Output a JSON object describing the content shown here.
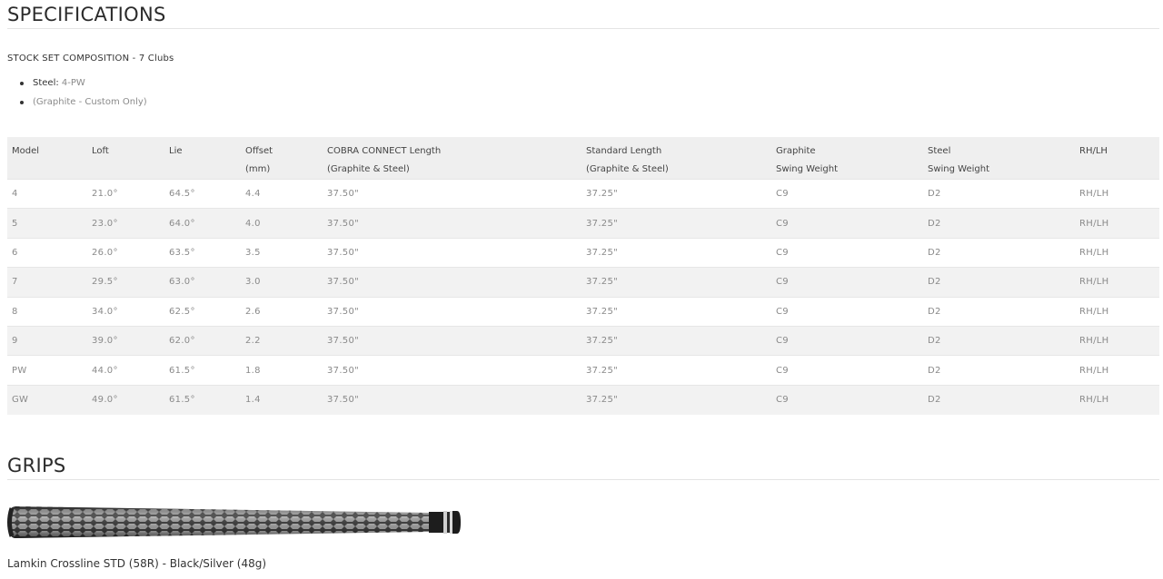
{
  "specs": {
    "title": "SPECIFICATIONS",
    "composition": "STOCK SET COMPOSITION - 7 Clubs",
    "bullets": {
      "steel_label": "Steel:",
      "steel_value": "4-PW",
      "graphite": "(Graphite - Custom Only)"
    },
    "headers": [
      {
        "l1": "Model",
        "l2": ""
      },
      {
        "l1": "Loft",
        "l2": ""
      },
      {
        "l1": "Lie",
        "l2": ""
      },
      {
        "l1": "Offset",
        "l2": "(mm)"
      },
      {
        "l1": "COBRA CONNECT Length",
        "l2": "(Graphite & Steel)"
      },
      {
        "l1": "Standard Length",
        "l2": "(Graphite & Steel)"
      },
      {
        "l1": "Graphite",
        "l2": "Swing Weight"
      },
      {
        "l1": "Steel",
        "l2": "Swing Weight"
      },
      {
        "l1": "RH/LH",
        "l2": ""
      }
    ],
    "rows": [
      [
        "4",
        "21.0°",
        "64.5°",
        "4.4",
        "37.50\"",
        "37.25\"",
        "C9",
        "D2",
        "RH/LH"
      ],
      [
        "5",
        "23.0°",
        "64.0°",
        "4.0",
        "37.50\"",
        "37.25\"",
        "C9",
        "D2",
        "RH/LH"
      ],
      [
        "6",
        "26.0°",
        "63.5°",
        "3.5",
        "37.50\"",
        "37.25\"",
        "C9",
        "D2",
        "RH/LH"
      ],
      [
        "7",
        "29.5°",
        "63.0°",
        "3.0",
        "37.50\"",
        "37.25\"",
        "C9",
        "D2",
        "RH/LH"
      ],
      [
        "8",
        "34.0°",
        "62.5°",
        "2.6",
        "37.50\"",
        "37.25\"",
        "C9",
        "D2",
        "RH/LH"
      ],
      [
        "9",
        "39.0°",
        "62.0°",
        "2.2",
        "37.50\"",
        "37.25\"",
        "C9",
        "D2",
        "RH/LH"
      ],
      [
        "PW",
        "44.0°",
        "61.5°",
        "1.8",
        "37.50\"",
        "37.25\"",
        "C9",
        "D2",
        "RH/LH"
      ],
      [
        "GW",
        "49.0°",
        "61.5°",
        "1.4",
        "37.50\"",
        "37.25\"",
        "C9",
        "D2",
        "RH/LH"
      ]
    ]
  },
  "grips": {
    "title": "GRIPS",
    "caption": "Lamkin Crossline STD (58R) - Black/Silver (48g)"
  }
}
